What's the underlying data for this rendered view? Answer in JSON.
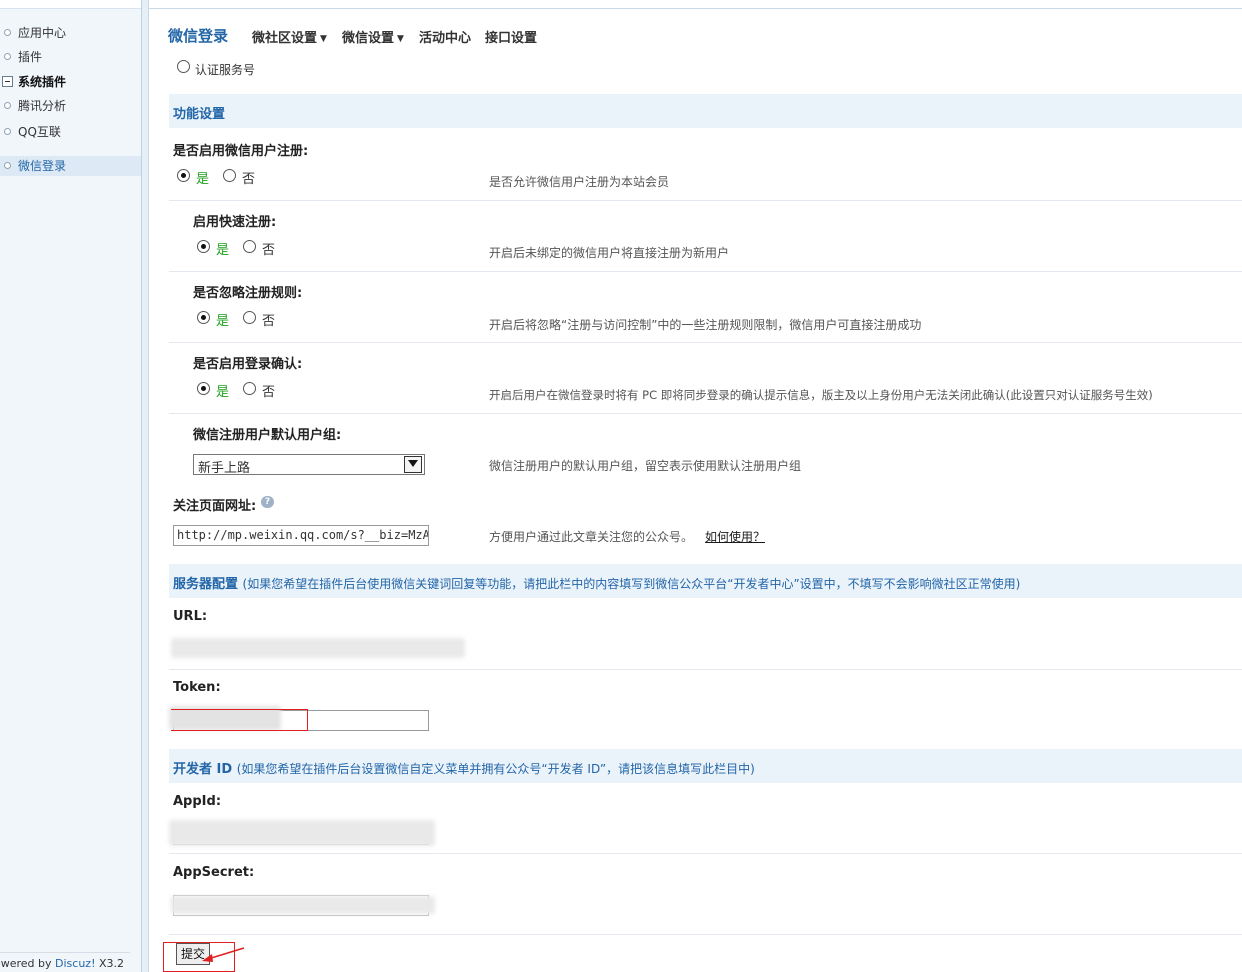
{
  "sidebar": {
    "items": [
      {
        "label": "应用中心"
      },
      {
        "label": "插件"
      },
      {
        "label": "系统插件"
      },
      {
        "label": "腾讯分析"
      },
      {
        "label": "QQ互联"
      },
      {
        "label": "微信登录"
      }
    ],
    "footer": {
      "prefix": "owered by ",
      "brand": "Discuz!",
      "version": " X3.2"
    }
  },
  "nav": {
    "title": "微信登录",
    "tabs": [
      {
        "label": "微社区设置",
        "caret": "▼"
      },
      {
        "label": "微信设置",
        "caret": "▼"
      },
      {
        "label": "活动中心"
      },
      {
        "label": "接口设置"
      }
    ]
  },
  "partial_option": "认证服务号",
  "sections": {
    "function": {
      "title": "功能设置"
    },
    "server": {
      "title": "服务器配置",
      "note": "(如果您希望在插件后台使用微信关键词回复等功能，请把此栏中的内容填写到微信公众平台“开发者中心”设置中，不填写不会影响微社区正常使用)"
    },
    "developer": {
      "title": "开发者 ID",
      "note": "(如果您希望在插件后台设置微信自定义菜单并拥有公众号“开发者 ID”，请把该信息填写此栏目中)"
    }
  },
  "radio": {
    "yes": "是",
    "no": "否"
  },
  "settings": [
    {
      "label": "是否启用微信用户注册:",
      "tip": "是否允许微信用户注册为本站会员",
      "value": "是"
    },
    {
      "label": "启用快速注册:",
      "tip": "开启后未绑定的微信用户将直接注册为新用户",
      "value": "是"
    },
    {
      "label": "是否忽略注册规则:",
      "tip": "开启后将忽略“注册与访问控制”中的一些注册规则限制，微信用户可直接注册成功",
      "value": "是"
    },
    {
      "label": "是否启用登录确认:",
      "tip": "开启后用户在微信登录时将有 PC 即将同步登录的确认提示信息，版主及以上身份用户无法关闭此确认(此设置只对认证服务号生效)",
      "value": "是"
    }
  ],
  "usergroup": {
    "label": "微信注册用户默认用户组:",
    "value": "新手上路",
    "tip": "微信注册用户的默认用户组，留空表示使用默认注册用户组"
  },
  "follow": {
    "label": "关注页面网址:",
    "value": "http://mp.weixin.qq.com/s?__biz=MzAwO",
    "tip": "方便用户通过此文章关注您的公众号。",
    "link": "如何使用？",
    "help": "?"
  },
  "fields": {
    "url": "URL:",
    "token": "Token:",
    "appid": "AppId:",
    "appsecret": "AppSecret:"
  },
  "submit": "提交"
}
